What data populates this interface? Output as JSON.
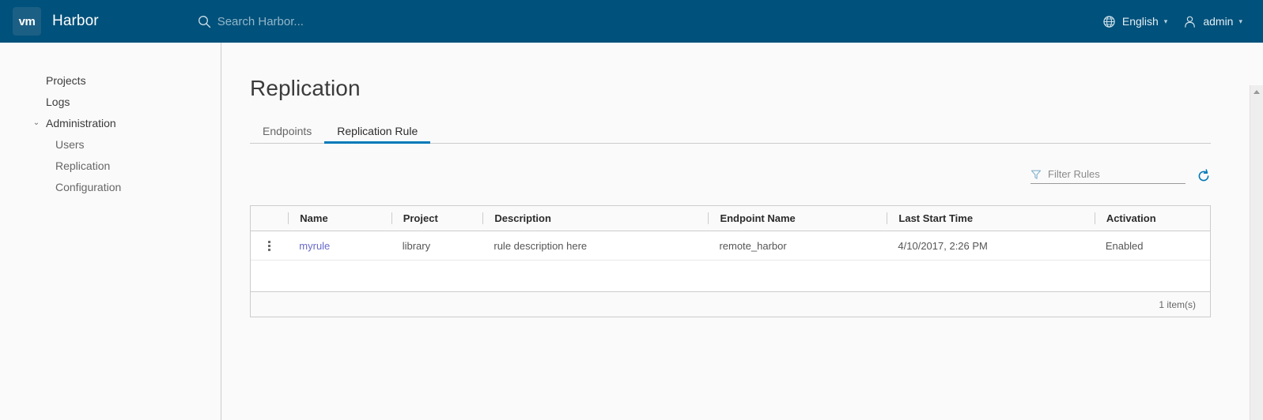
{
  "colors": {
    "header_bg": "#00517b",
    "accent": "#0079b8",
    "link": "#6a6acb",
    "logo_bg": "#1c5f84"
  },
  "header": {
    "logo_text": "vm",
    "brand_title": "Harbor",
    "search": {
      "icon": "search-icon",
      "placeholder": "Search Harbor..."
    },
    "language": {
      "icon": "globe-icon",
      "label": "English",
      "caret": "⌄"
    },
    "account": {
      "icon": "user-icon",
      "label": "admin",
      "caret": "⌄"
    }
  },
  "sidebar": {
    "items": [
      {
        "label": "Projects",
        "level": "top"
      },
      {
        "label": "Logs",
        "level": "top"
      },
      {
        "label": "Administration",
        "level": "group",
        "chevron": "⌄"
      },
      {
        "label": "Users",
        "level": "child"
      },
      {
        "label": "Replication",
        "level": "child"
      },
      {
        "label": "Configuration",
        "level": "child"
      }
    ]
  },
  "main": {
    "page_title": "Replication",
    "tabs": [
      {
        "label": "Endpoints",
        "active": false
      },
      {
        "label": "Replication Rule",
        "active": true
      }
    ],
    "toolbar": {
      "filter_icon": "filter-icon",
      "filter_placeholder": "Filter Rules",
      "filter_value": "",
      "refresh_icon": "refresh-icon"
    },
    "table": {
      "columns": [
        "Name",
        "Project",
        "Description",
        "Endpoint Name",
        "Last Start Time",
        "Activation"
      ],
      "rows": [
        {
          "actions_icon": "kebab-menu-icon",
          "name": "myrule",
          "project": "library",
          "description": "rule description here",
          "endpoint_name": "remote_harbor",
          "last_start_time": "4/10/2017, 2:26 PM",
          "activation": "Enabled"
        }
      ],
      "footer_count": "1 item(s)"
    }
  }
}
